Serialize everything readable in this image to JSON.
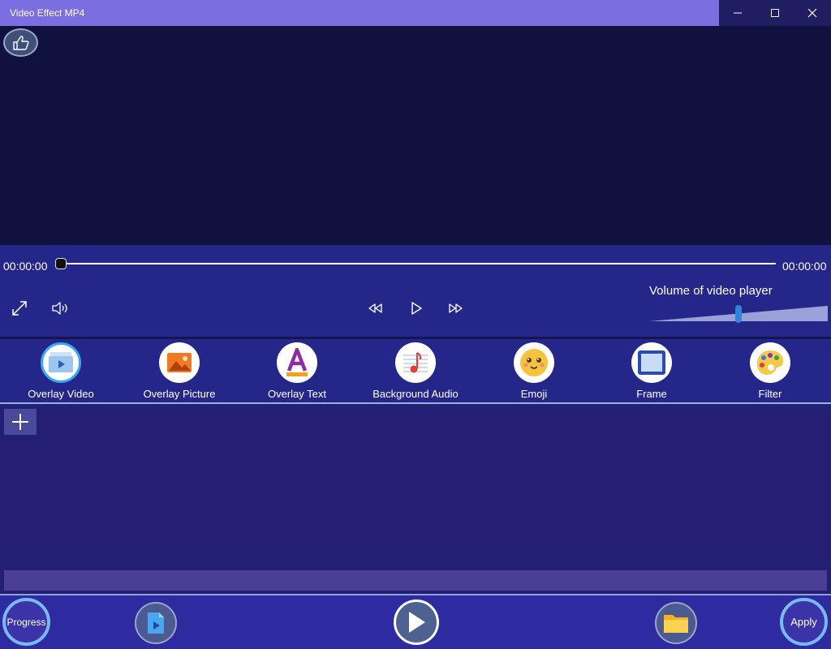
{
  "window": {
    "title": "Video Effect MP4"
  },
  "player": {
    "current_time": "00:00:00",
    "total_time": "00:00:00",
    "progress": 0,
    "volume_label": "Volume of video player",
    "volume_level": 0.5
  },
  "effects": [
    {
      "label": "Overlay Video",
      "icon": "overlay-video-icon"
    },
    {
      "label": "Overlay Picture",
      "icon": "overlay-picture-icon"
    },
    {
      "label": "Overlay Text",
      "icon": "overlay-text-icon"
    },
    {
      "label": "Background Audio",
      "icon": "background-audio-icon"
    },
    {
      "label": "Emoji",
      "icon": "emoji-icon"
    },
    {
      "label": "Frame",
      "icon": "frame-icon"
    },
    {
      "label": "Filter",
      "icon": "filter-icon"
    }
  ],
  "bottom": {
    "progress_label": "Progress",
    "apply_label": "Apply"
  },
  "colors": {
    "accent": "#7b6ee0",
    "video_bg": "#11113f",
    "panel": "#25268a"
  }
}
